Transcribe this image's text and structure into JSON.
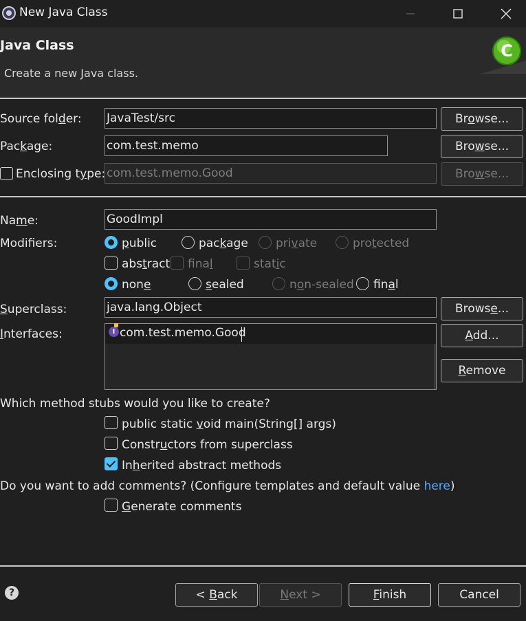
{
  "window": {
    "title": "New Java Class",
    "minimize_icon": "minimize-icon",
    "maximize_icon": "maximize-icon",
    "close_icon": "close-icon"
  },
  "header": {
    "title": "Java Class",
    "description": "Create a new Java class."
  },
  "source_folder": {
    "label": "Source folder:",
    "value": "JavaTest/src",
    "browse": "Browse..."
  },
  "package": {
    "label": "Package:",
    "value": "com.test.memo",
    "browse": "Browse..."
  },
  "enclosing": {
    "label": "Enclosing type:",
    "value": "com.test.memo.Good",
    "browse": "Browse..."
  },
  "name": {
    "label": "Name:",
    "value": "GoodImpl"
  },
  "modifiers": {
    "label": "Modifiers:",
    "access": [
      "public",
      "package",
      "private",
      "protected"
    ],
    "selected_access": "public",
    "flags": [
      "abstract",
      "final",
      "static"
    ],
    "sealing": [
      "none",
      "sealed",
      "non-sealed",
      "final"
    ],
    "selected_sealing": "none"
  },
  "superclass": {
    "label": "Superclass:",
    "value": "java.lang.Object",
    "browse": "Browse..."
  },
  "interfaces": {
    "label": "Interfaces:",
    "items": [
      "com.test.memo.Good"
    ],
    "add": "Add...",
    "remove": "Remove"
  },
  "stubs": {
    "question": "Which method stubs would you like to create?",
    "options": [
      {
        "label": "public static void main(String[] args)",
        "checked": false
      },
      {
        "label": "Constructors from superclass",
        "checked": false
      },
      {
        "label": "Inherited abstract methods",
        "checked": true
      }
    ]
  },
  "comments": {
    "question": "Do you want to add comments? (Configure templates and default value ",
    "link": "here",
    "question_end": ")",
    "option": "Generate comments"
  },
  "footer": {
    "back": "< Back",
    "next": "Next >",
    "finish": "Finish",
    "cancel": "Cancel",
    "help": "?"
  },
  "colors": {
    "accent": "#4cc2ff",
    "link": "#4fa8ff",
    "background": "#202020"
  }
}
